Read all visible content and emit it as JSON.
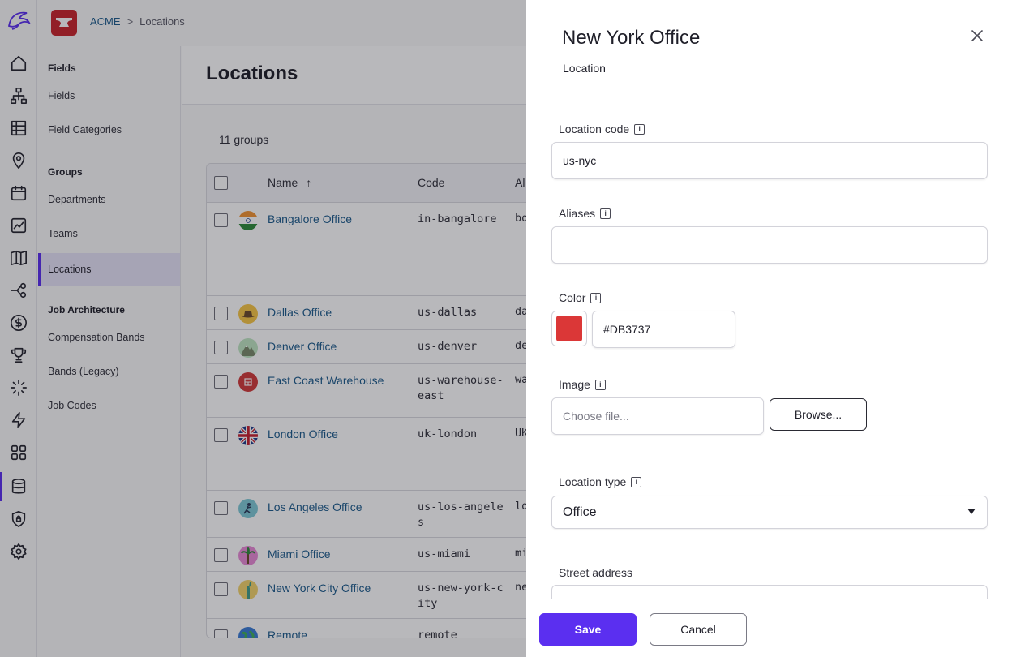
{
  "breadcrumb": {
    "company": "ACME",
    "separator": ">",
    "current": "Locations"
  },
  "sidebar": {
    "sections": [
      {
        "title": "Fields",
        "items": [
          "Fields",
          "Field Categories"
        ]
      },
      {
        "title": "Groups",
        "items": [
          "Departments",
          "Teams",
          "Locations"
        ]
      },
      {
        "title": "Job Architecture",
        "items": [
          "Compensation Bands",
          "Bands (Legacy)",
          "Job Codes"
        ]
      }
    ],
    "active_item": "Locations"
  },
  "main": {
    "title": "Locations",
    "group_count": "11 groups",
    "columns": {
      "name": "Name",
      "sort": "↑",
      "code": "Code",
      "aliases": "Al"
    },
    "rows": [
      {
        "name": "Bangalore Office",
        "code": "in-bangalore",
        "alias": "bo"
      },
      {
        "name": "Dallas Office",
        "code": "us-dallas",
        "alias": "da"
      },
      {
        "name": "Denver Office",
        "code": "us-denver",
        "alias": "de"
      },
      {
        "name": "East Coast Warehouse",
        "code": "us-warehouse-east",
        "alias": "wa"
      },
      {
        "name": "London Office",
        "code": "uk-london",
        "alias": "UK"
      },
      {
        "name": "Los Angeles Office",
        "code": "us-los-angeles",
        "alias": "lo"
      },
      {
        "name": "Miami Office",
        "code": "us-miami",
        "alias": "mi"
      },
      {
        "name": "New York City Office",
        "code": "us-new-york-city",
        "alias": "ne"
      },
      {
        "name": "Remote",
        "code": "remote",
        "alias": ""
      }
    ]
  },
  "drawer": {
    "title": "New York Office",
    "subtitle": "Location",
    "location_code": {
      "label": "Location code",
      "value": "us-nyc"
    },
    "aliases": {
      "label": "Aliases",
      "value": ""
    },
    "color": {
      "label": "Color",
      "value": "#DB3737"
    },
    "image": {
      "label": "Image",
      "placeholder": "Choose file...",
      "browse": "Browse..."
    },
    "location_type": {
      "label": "Location type",
      "value": "Office"
    },
    "street_address": {
      "label": "Street address"
    },
    "save": "Save",
    "cancel": "Cancel"
  },
  "colors": {
    "accent": "#5B2FF0",
    "brand": "#C9252C",
    "link": "#1C5B8C",
    "swatch": "#DB3737"
  }
}
